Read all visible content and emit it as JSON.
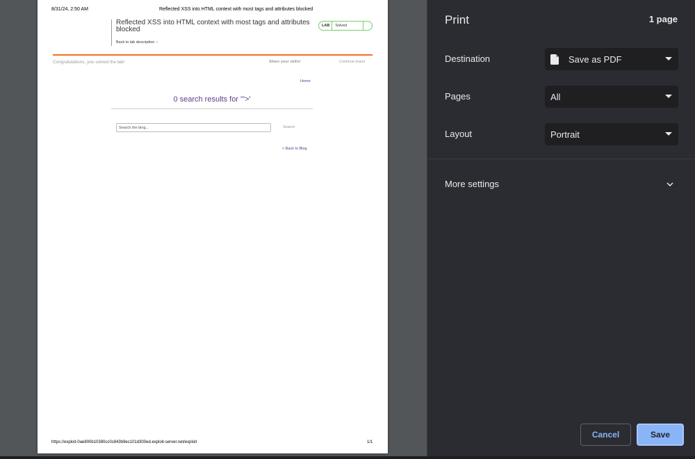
{
  "preview": {
    "header_date": "8/31/24, 2:50 AM",
    "header_title": "Reflected XSS into HTML context with most tags and attributes blocked",
    "lab_title": "Reflected XSS into HTML context with most tags and attributes blocked",
    "back_link": "Back to lab description",
    "back_chevron": "»",
    "badge_lab": "LAB",
    "badge_status": "Solved",
    "congrats": "Congratulations, you solved the lab!",
    "share": "Share your skills!",
    "continue": "Continue learni",
    "home": "Home",
    "results": "0 search results for '\">'",
    "search_placeholder": "Search the blog...",
    "search_button": "Search",
    "back_to_blog": "< Back to Blog",
    "footer_url": "https://exploit-0ae800b10380cc0c843b9ec101d300ed.exploit-server.net/exploit",
    "footer_page": "1/1"
  },
  "panel": {
    "title": "Print",
    "page_count": "1 page",
    "destination_label": "Destination",
    "destination_value": "Save as PDF",
    "pages_label": "Pages",
    "pages_value": "All",
    "layout_label": "Layout",
    "layout_value": "Portrait",
    "more_settings": "More settings",
    "cancel": "Cancel",
    "save": "Save"
  },
  "colors": {
    "panel_bg": "#2b2c31",
    "accent": "#8ab4f8",
    "lab_solved": "#70d16d",
    "lab_orange": "#f36f1e"
  }
}
